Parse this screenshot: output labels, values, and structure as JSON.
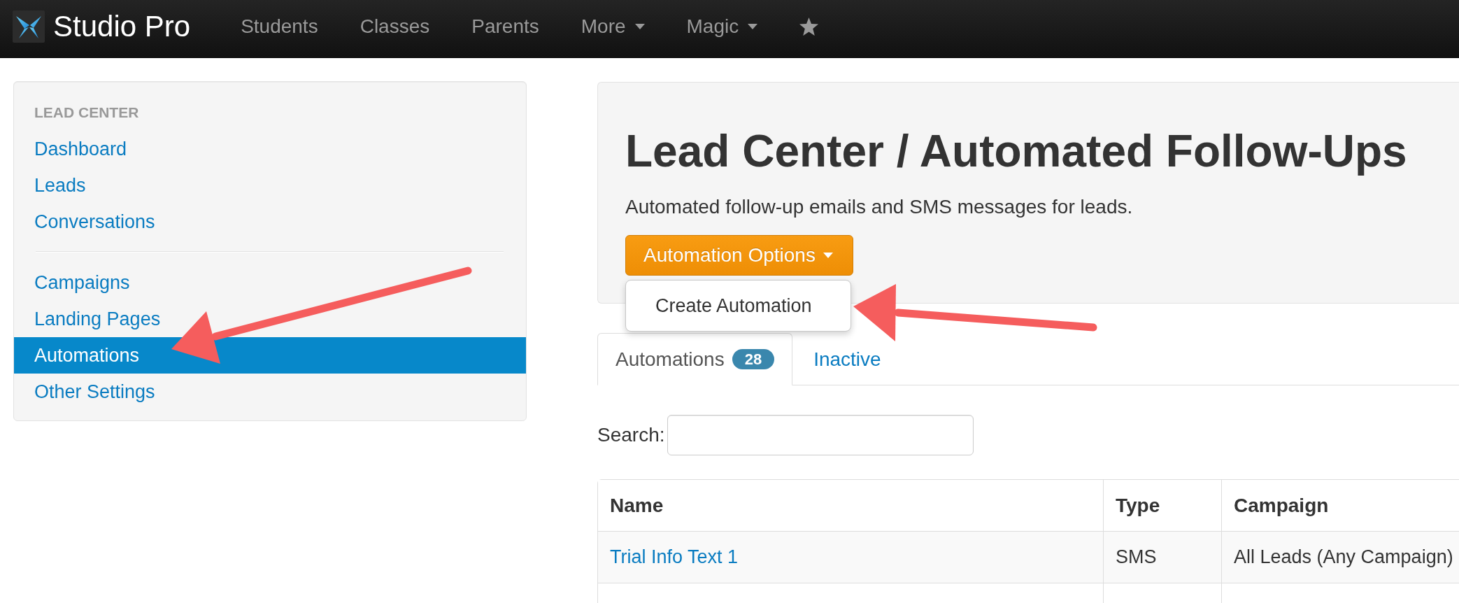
{
  "navbar": {
    "brand": "Studio Pro",
    "items": [
      {
        "kind": "link",
        "label": "Students"
      },
      {
        "kind": "link",
        "label": "Classes"
      },
      {
        "kind": "link",
        "label": "Parents"
      },
      {
        "kind": "dropdown",
        "label": "More"
      },
      {
        "kind": "dropdown",
        "label": "Magic"
      },
      {
        "kind": "star"
      }
    ]
  },
  "sidebar": {
    "header": "LEAD CENTER",
    "sections": [
      {
        "items": [
          {
            "label": "Dashboard",
            "selected": false
          },
          {
            "label": "Leads",
            "selected": false
          },
          {
            "label": "Conversations",
            "selected": false
          }
        ]
      },
      {
        "items": [
          {
            "label": "Campaigns",
            "selected": false
          },
          {
            "label": "Landing Pages",
            "selected": false
          },
          {
            "label": "Automations",
            "selected": true
          },
          {
            "label": "Other Settings",
            "selected": false
          }
        ]
      }
    ]
  },
  "header": {
    "title": "Lead Center / Automated Follow-Ups",
    "subtitle": "Automated follow-up emails and SMS messages for leads.",
    "options_button": "Automation Options",
    "options_menu": {
      "expanded": true,
      "items": [
        {
          "label": "Create Automation"
        }
      ]
    }
  },
  "tabs": [
    {
      "label": "Automations",
      "badge": "28",
      "selected": true
    },
    {
      "label": "Inactive",
      "selected": false
    }
  ],
  "search": {
    "label": "Search:"
  },
  "table": {
    "columns": [
      "Name",
      "Type",
      "Campaign"
    ],
    "rows": [
      {
        "name": "Trial Info Text 1",
        "type": "SMS",
        "campaign": "All Leads (Any Campaign)"
      }
    ]
  }
}
